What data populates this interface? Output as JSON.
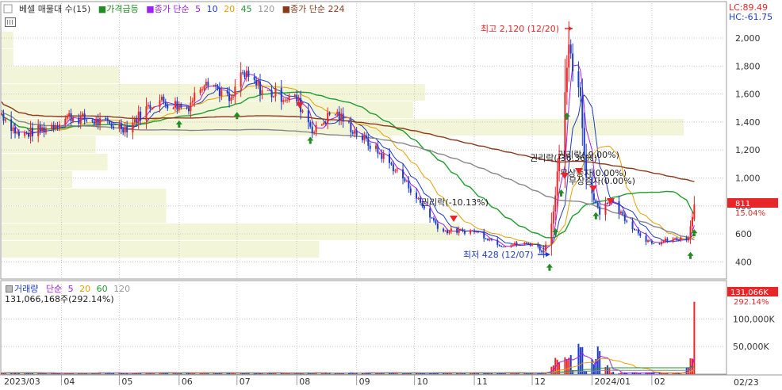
{
  "price_panel": {
    "legend": [
      {
        "text": "베셀 매물대 수(15)",
        "color": "#333333",
        "marker": "#999999"
      },
      {
        "text": "가격급등",
        "color": "#228b22",
        "marker": "#228b22"
      },
      {
        "text": "종가 단순",
        "color": "#a020f0",
        "marker": "#a020f0"
      },
      {
        "text": "5",
        "color": "#a020f0"
      },
      {
        "text": "10",
        "color": "#1e3cc8"
      },
      {
        "text": "20",
        "color": "#e6a000"
      },
      {
        "text": "45",
        "color": "#1f9e2f"
      },
      {
        "text": "120",
        "color": "#999999"
      },
      {
        "text": "종가 단순 224",
        "color": "#8b3a1a",
        "marker": "#8b3a1a"
      }
    ],
    "lc_label": "LC:89.49",
    "hc_label": "HC:-61.75",
    "high_label": "최고 2,120 (12/20)",
    "low_label": "최저 428 (12/07)",
    "annotations": [
      "권리락(-10.13%)",
      "권리락(-36.36%)",
      "권리락(-9.00%)",
      "무상증자(0.00%)",
      "무상증자(0.00%)"
    ],
    "current_price": "811",
    "current_change": "15.04%"
  },
  "volume_panel": {
    "legend": [
      {
        "text": "거래량",
        "color": "#1e3cc8"
      },
      {
        "text": "단순",
        "color": "#a020f0"
      },
      {
        "text": "5",
        "color": "#a020f0"
      },
      {
        "text": "20",
        "color": "#e6a000"
      },
      {
        "text": "60",
        "color": "#1f9e2f"
      },
      {
        "text": "120",
        "color": "#999999"
      }
    ],
    "summary": "131,066,168주(292.14%)",
    "current_volume": "131,066K",
    "current_change": "292.14%"
  },
  "x_axis": {
    "labels": [
      "2023/03",
      "04",
      "05",
      "06",
      "07",
      "08",
      "09",
      "10",
      "11",
      "12",
      "2024/01",
      "02"
    ],
    "right_label": "02/23"
  },
  "colors": {
    "up": "#e8262a",
    "down": "#1e3cc8",
    "ma5": "#a020f0",
    "ma10": "#1e3cc8",
    "ma20": "#e6a000",
    "ma45": "#1f9e2f",
    "ma120": "#888888",
    "ma224": "#8b3a1a",
    "volume_profile": "#f2f5d8",
    "signal": "#228b22",
    "grid": "#c8c8c8"
  },
  "chart_data": [
    {
      "type": "candlestick",
      "title": "",
      "y_axis_ticks": [
        400,
        600,
        800,
        1000,
        1200,
        1400,
        1600,
        1800,
        2000
      ],
      "y_axis_tick_labels": [
        "400",
        "600",
        "800",
        "1,000",
        "1,200",
        "1,400",
        "1,600",
        "1,800",
        "2,000"
      ],
      "ylim": [
        300,
        2170
      ],
      "x_months": [
        "2023/03",
        "04",
        "05",
        "06",
        "07",
        "08",
        "09",
        "10",
        "11",
        "12",
        "2024/01",
        "02"
      ],
      "close_series_anchors": [
        {
          "date": "2023/03/01",
          "close": 1460
        },
        {
          "date": "2023/03/10",
          "close": 1300
        },
        {
          "date": "2023/03/25",
          "close": 1360
        },
        {
          "date": "2023/04/05",
          "close": 1440
        },
        {
          "date": "2023/04/20",
          "close": 1400
        },
        {
          "date": "2023/05/05",
          "close": 1360
        },
        {
          "date": "2023/05/20",
          "close": 1560
        },
        {
          "date": "2023/06/05",
          "close": 1500
        },
        {
          "date": "2023/06/15",
          "close": 1720
        },
        {
          "date": "2023/06/28",
          "close": 1540
        },
        {
          "date": "2023/07/03",
          "close": 1750
        },
        {
          "date": "2023/07/15",
          "close": 1620
        },
        {
          "date": "2023/08/01",
          "close": 1560
        },
        {
          "date": "2023/08/10",
          "close": 1330
        },
        {
          "date": "2023/08/20",
          "close": 1480
        },
        {
          "date": "2023/09/01",
          "close": 1320
        },
        {
          "date": "2023/09/15",
          "close": 1150
        },
        {
          "date": "2023/09/25",
          "close": 1000
        },
        {
          "date": "2023/10/05",
          "close": 800
        },
        {
          "date": "2023/10/15",
          "close": 620
        },
        {
          "date": "2023/11/01",
          "close": 620
        },
        {
          "date": "2023/11/15",
          "close": 520
        },
        {
          "date": "2023/12/01",
          "close": 530
        },
        {
          "date": "2023/12/07",
          "close": 470
        },
        {
          "date": "2023/12/12",
          "close": 750
        },
        {
          "date": "2023/12/15",
          "close": 1200
        },
        {
          "date": "2023/12/20",
          "close": 1900
        },
        {
          "date": "2023/12/26",
          "close": 1550
        },
        {
          "date": "2023/12/29",
          "close": 1000
        },
        {
          "date": "2024/01/05",
          "close": 760
        },
        {
          "date": "2024/01/10",
          "close": 850
        },
        {
          "date": "2024/01/20",
          "close": 680
        },
        {
          "date": "2024/02/01",
          "close": 520
        },
        {
          "date": "2024/02/10",
          "close": 560
        },
        {
          "date": "2024/02/20",
          "close": 560
        },
        {
          "date": "2024/02/23",
          "close": 811
        }
      ],
      "series": [
        {
          "name": "5",
          "period": 5
        },
        {
          "name": "10",
          "period": 10
        },
        {
          "name": "20",
          "period": 20
        },
        {
          "name": "45",
          "period": 45
        },
        {
          "name": "120",
          "period": 120
        },
        {
          "name": "224",
          "period": 224
        }
      ],
      "annotations": [
        {
          "date": "2023/12/20",
          "value": 2120,
          "text": "최고 2,120 (12/20)"
        },
        {
          "date": "2023/12/07",
          "value": 428,
          "text": "최저 428 (12/07)"
        }
      ],
      "volume_profile_bins": 15,
      "grid": true
    },
    {
      "type": "bar",
      "title": "",
      "y_axis_ticks": [
        50000,
        100000
      ],
      "y_axis_tick_labels": [
        "50,000K",
        "100,000K"
      ],
      "ylim": [
        0,
        135000
      ],
      "unit": "K shares",
      "last_value": 131066,
      "spike_anchors": [
        {
          "date": "2023/12/12",
          "value": 18000
        },
        {
          "date": "2023/12/14",
          "value": 30000
        },
        {
          "date": "2023/12/18",
          "value": 42000
        },
        {
          "date": "2023/12/20",
          "value": 36000
        },
        {
          "date": "2023/12/26",
          "value": 52000
        },
        {
          "date": "2024/01/02",
          "value": 26000
        },
        {
          "date": "2024/01/05",
          "value": 62000
        },
        {
          "date": "2024/01/08",
          "value": 15000
        },
        {
          "date": "2024/02/20",
          "value": 12000
        },
        {
          "date": "2024/02/22",
          "value": 28000
        }
      ],
      "grid": true
    }
  ]
}
